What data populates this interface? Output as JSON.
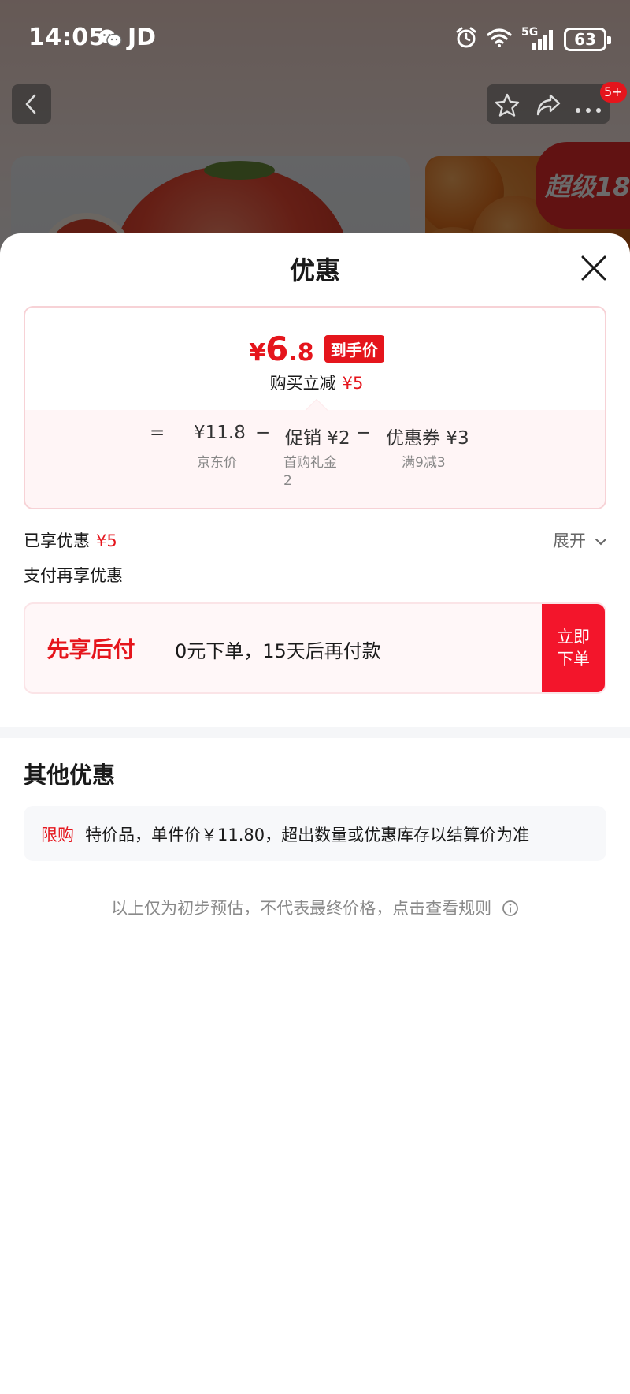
{
  "status_bar": {
    "time": "14:05",
    "carrier": "JD",
    "network": "5G",
    "battery": "63"
  },
  "background": {
    "badge_5plus": "5+",
    "promo_badge": "超级18"
  },
  "sheet": {
    "title": "优惠",
    "price_card": {
      "final_price_yen": "¥",
      "final_price_int": "6",
      "final_price_dec": ".8",
      "final_tag": "到手价",
      "instant_label": "购买立减",
      "instant_amount": "¥5",
      "formula": {
        "equals": "=",
        "jd_price": "¥11.8",
        "jd_price_label": "京东价",
        "minus1": "−",
        "promo": "促销 ¥2",
        "promo_label_line1": "首购礼金",
        "promo_label_line2": "2",
        "minus2": "−",
        "coupon": "优惠券 ¥3",
        "coupon_label": "满9减3"
      }
    },
    "enjoyed_label": "已享优惠",
    "enjoyed_amount": "¥5",
    "expand_label": "展开",
    "pay_hint": "支付再享优惠",
    "bnpl": {
      "title": "先享后付",
      "text": "0元下单，15天后再付款",
      "button": "立即下单"
    },
    "other_title": "其他优惠",
    "limit": {
      "tag": "限购",
      "text": "特价品，单件价￥11.80，超出数量或优惠库存以结算价为准"
    },
    "disclaimer": "以上仅为初步预估，不代表最终价格，点击查看规则"
  },
  "colors": {
    "accent_red": "#e5151c",
    "button_red": "#f3152b"
  }
}
